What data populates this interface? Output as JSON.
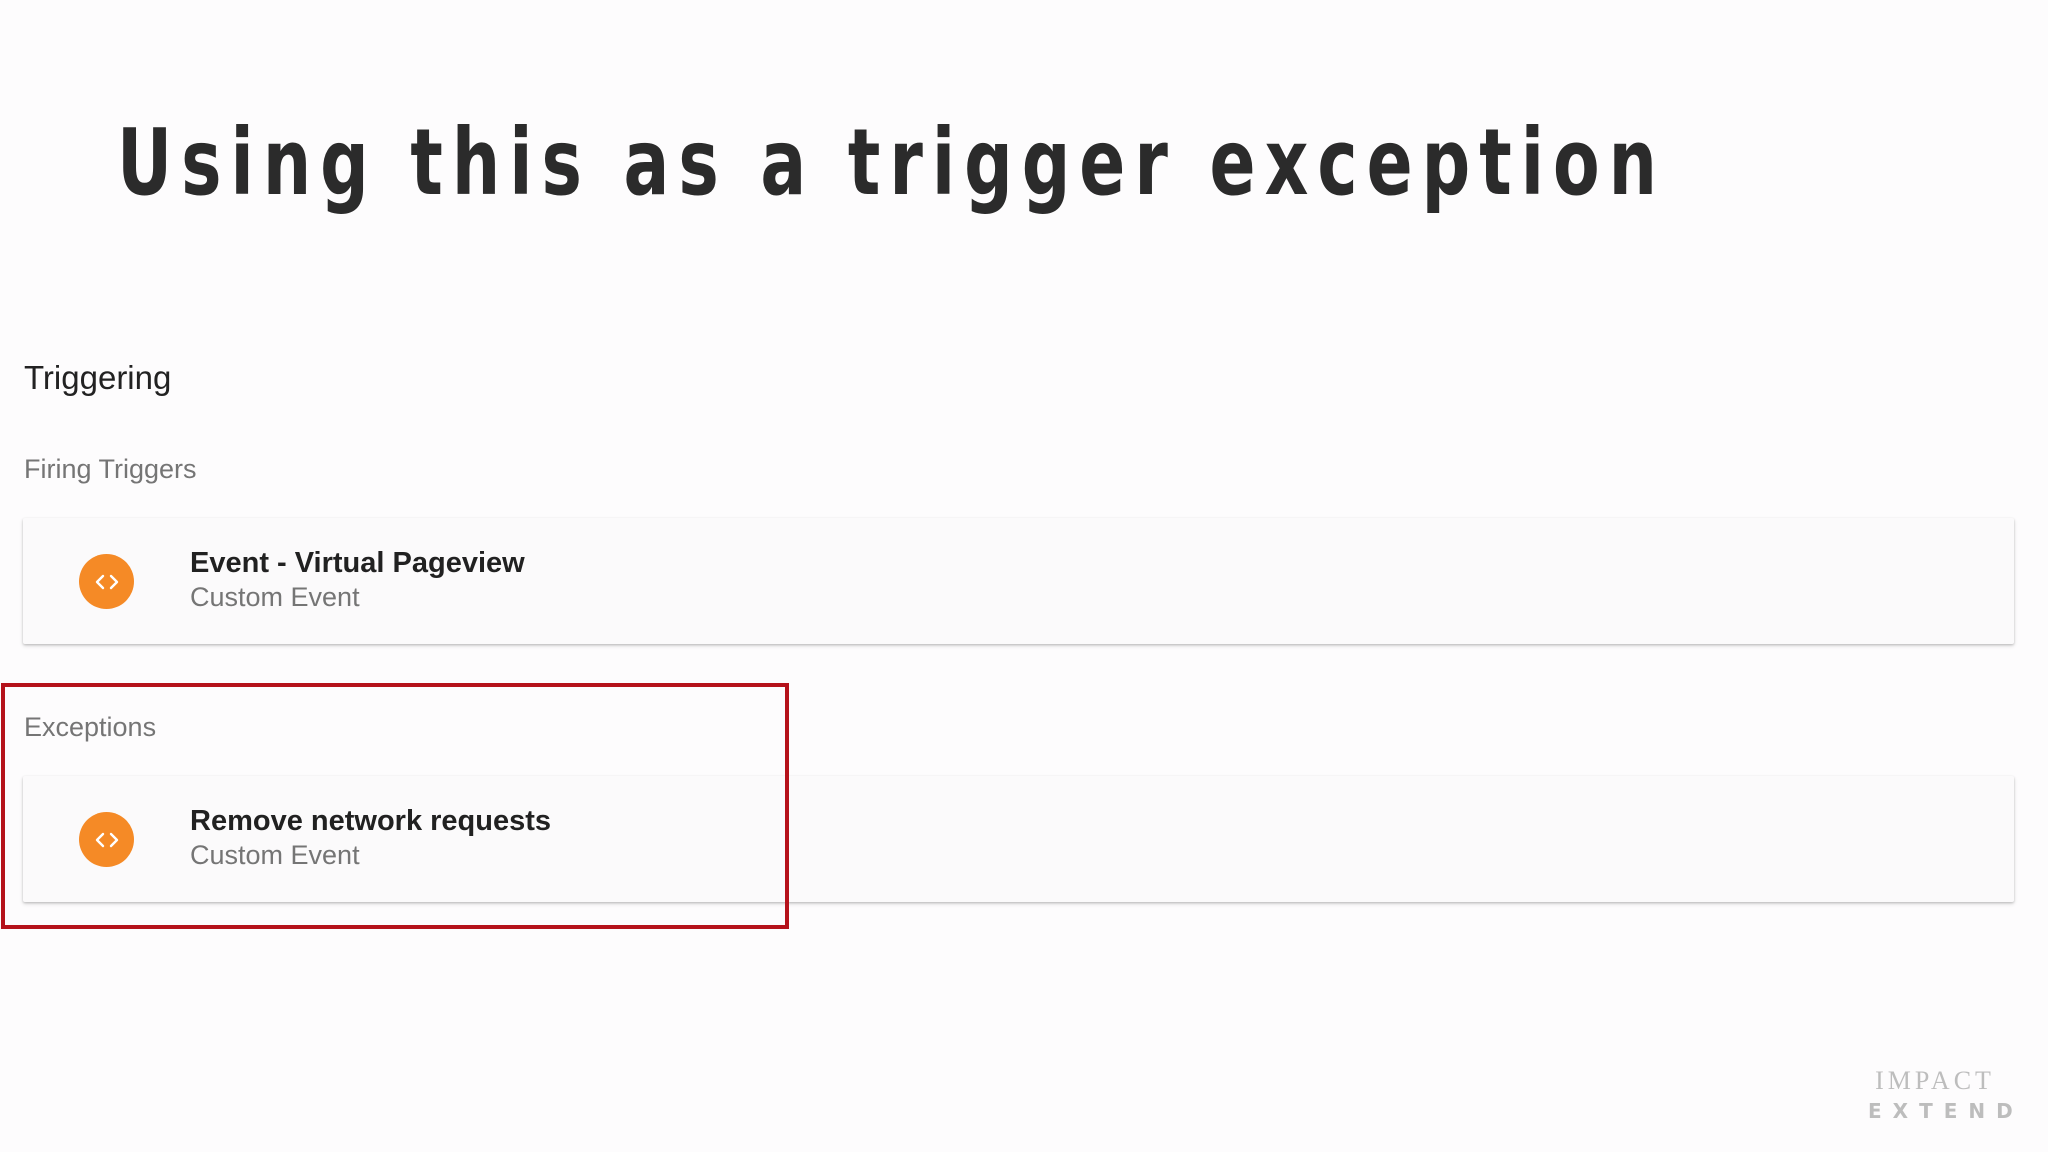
{
  "slide": {
    "title": "Using this as a trigger exception"
  },
  "triggering": {
    "heading": "Triggering",
    "firing_label": "Firing Triggers",
    "firing_triggers": [
      {
        "name": "Event - Virtual Pageview",
        "type": "Custom Event",
        "icon": "custom-event-code-icon"
      }
    ],
    "exceptions_label": "Exceptions",
    "exceptions": [
      {
        "name": "Remove network requests",
        "type": "Custom Event",
        "icon": "custom-event-code-icon"
      }
    ]
  },
  "brand": {
    "line1": "IMPACT",
    "line2": "EXTEND"
  },
  "colors": {
    "icon_orange": "#f58a26",
    "highlight_red": "#b5121b",
    "muted_text": "#757575"
  }
}
